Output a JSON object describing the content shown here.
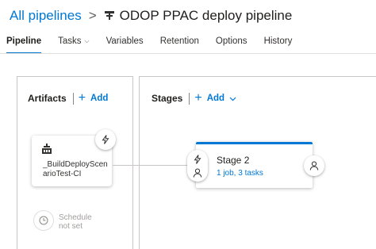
{
  "header": {
    "breadcrumb_root": "All pipelines",
    "separator": ">",
    "title": "ODOP PPAC deploy pipeline",
    "title_icon": "pipeline-icon"
  },
  "tabs": [
    {
      "label": "Pipeline",
      "active": true
    },
    {
      "label": "Tasks",
      "has_dropdown": true
    },
    {
      "label": "Variables"
    },
    {
      "label": "Retention"
    },
    {
      "label": "Options"
    },
    {
      "label": "History"
    }
  ],
  "artifacts": {
    "title": "Artifacts",
    "add_label": "Add",
    "card": {
      "name": "_BuildDeployScenarioTest-CI",
      "icon": "build-icon",
      "trigger_icon": "lightning-icon"
    },
    "schedule": {
      "line1": "Schedule",
      "line2": "not set",
      "icon": "clock-icon"
    }
  },
  "stages": {
    "title": "Stages",
    "add_label": "Add",
    "card": {
      "name": "Stage 2",
      "summary": "1 job, 3 tasks"
    },
    "pre_icons": [
      "lightning-icon",
      "person-icon"
    ],
    "post_icon": "person-icon"
  },
  "colors": {
    "accent": "#0078d4",
    "text": "#323130",
    "muted": "#a19f9d",
    "border": "#c8c6c4"
  }
}
